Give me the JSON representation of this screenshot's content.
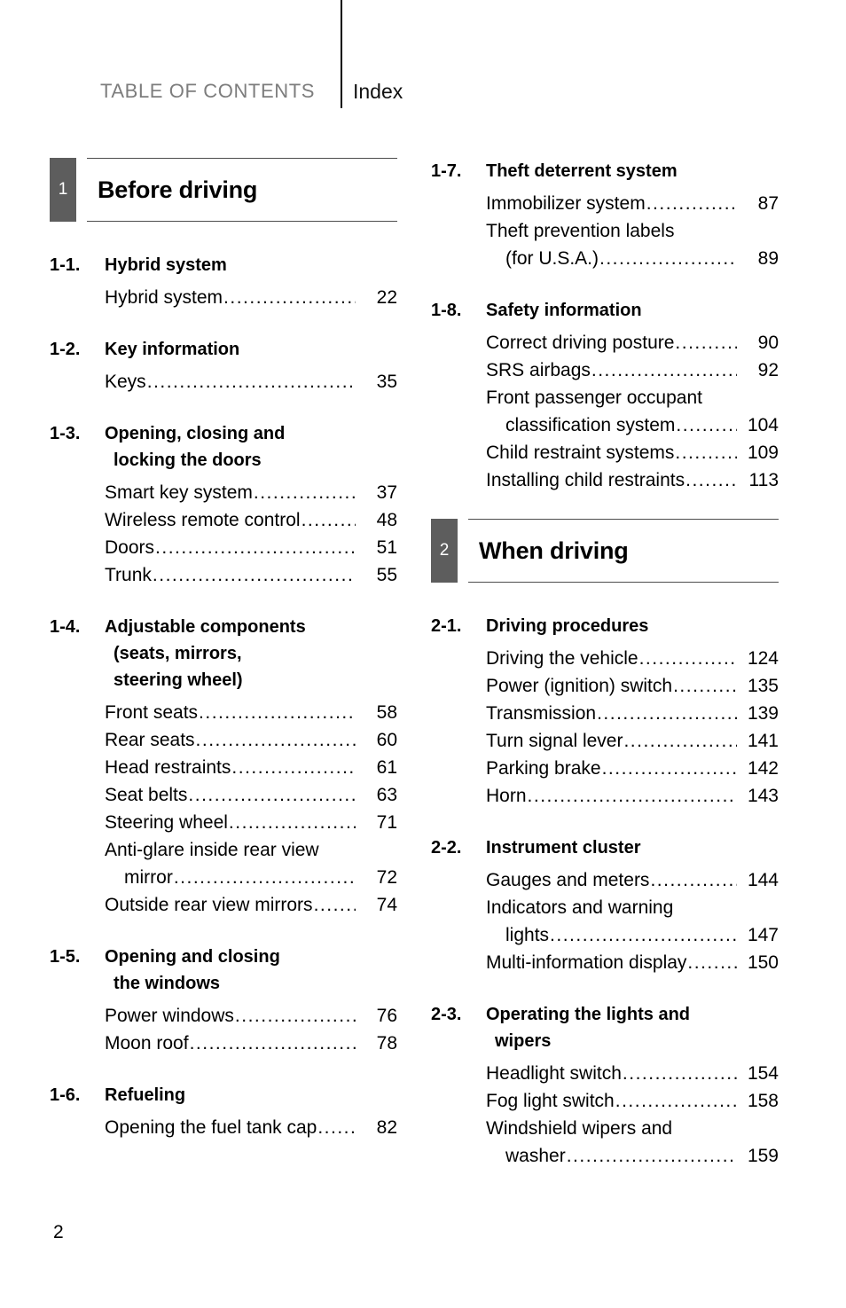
{
  "header": {
    "toc_label": "TABLE OF CONTENTS",
    "index_label": "Index"
  },
  "folio": "2",
  "colors": {
    "chapter_box": "#5d5d5d",
    "header_gray": "#7d7d7d",
    "rule": "#4d4d4d"
  },
  "left_column": {
    "chapter": {
      "number": "1",
      "title": "Before driving"
    },
    "sections": [
      {
        "no": "1-1.",
        "title_lines": [
          "Hybrid system"
        ],
        "entries": [
          {
            "lines": [
              "Hybrid system"
            ],
            "page": "22"
          }
        ]
      },
      {
        "no": "1-2.",
        "title_lines": [
          "Key information"
        ],
        "entries": [
          {
            "lines": [
              "Keys"
            ],
            "page": "35"
          }
        ]
      },
      {
        "no": "1-3.",
        "title_lines": [
          "Opening, closing and",
          "locking the doors"
        ],
        "entries": [
          {
            "lines": [
              "Smart key system"
            ],
            "page": "37"
          },
          {
            "lines": [
              "Wireless remote control"
            ],
            "page": "48"
          },
          {
            "lines": [
              "Doors"
            ],
            "page": "51"
          },
          {
            "lines": [
              "Trunk"
            ],
            "page": "55"
          }
        ]
      },
      {
        "no": "1-4.",
        "title_lines": [
          "Adjustable components",
          "(seats, mirrors,",
          "steering wheel)"
        ],
        "entries": [
          {
            "lines": [
              "Front seats"
            ],
            "page": "58"
          },
          {
            "lines": [
              "Rear seats"
            ],
            "page": "60"
          },
          {
            "lines": [
              "Head restraints"
            ],
            "page": "61"
          },
          {
            "lines": [
              "Seat belts"
            ],
            "page": "63"
          },
          {
            "lines": [
              "Steering wheel"
            ],
            "page": "71"
          },
          {
            "lines": [
              "Anti-glare inside rear view",
              "mirror"
            ],
            "page": "72"
          },
          {
            "lines": [
              "Outside rear view mirrors"
            ],
            "page": "74"
          }
        ]
      },
      {
        "no": "1-5.",
        "title_lines": [
          "Opening and closing",
          "the windows"
        ],
        "entries": [
          {
            "lines": [
              "Power windows"
            ],
            "page": "76"
          },
          {
            "lines": [
              "Moon roof"
            ],
            "page": "78"
          }
        ]
      },
      {
        "no": "1-6.",
        "title_lines": [
          "Refueling"
        ],
        "entries": [
          {
            "lines": [
              "Opening the fuel tank cap"
            ],
            "page": "82"
          }
        ]
      }
    ]
  },
  "right_column": {
    "sections_before_chapter": [
      {
        "no": "1-7.",
        "title_lines": [
          "Theft deterrent system"
        ],
        "entries": [
          {
            "lines": [
              "Immobilizer system"
            ],
            "page": "87"
          },
          {
            "lines": [
              "Theft prevention labels",
              "(for U.S.A.)"
            ],
            "page": "89"
          }
        ]
      },
      {
        "no": "1-8.",
        "title_lines": [
          "Safety information"
        ],
        "entries": [
          {
            "lines": [
              "Correct driving posture"
            ],
            "page": "90"
          },
          {
            "lines": [
              "SRS airbags"
            ],
            "page": "92"
          },
          {
            "lines": [
              "Front passenger occupant",
              "classification system"
            ],
            "page": "104"
          },
          {
            "lines": [
              "Child restraint systems"
            ],
            "page": "109"
          },
          {
            "lines": [
              "Installing child restraints"
            ],
            "page": "113"
          }
        ]
      }
    ],
    "chapter": {
      "number": "2",
      "title": "When driving"
    },
    "sections": [
      {
        "no": "2-1.",
        "title_lines": [
          "Driving procedures"
        ],
        "entries": [
          {
            "lines": [
              "Driving the vehicle"
            ],
            "page": "124"
          },
          {
            "lines": [
              "Power (ignition) switch"
            ],
            "page": "135"
          },
          {
            "lines": [
              "Transmission"
            ],
            "page": "139"
          },
          {
            "lines": [
              "Turn signal lever"
            ],
            "page": "141"
          },
          {
            "lines": [
              "Parking brake"
            ],
            "page": "142"
          },
          {
            "lines": [
              "Horn"
            ],
            "page": "143"
          }
        ]
      },
      {
        "no": "2-2.",
        "title_lines": [
          "Instrument cluster"
        ],
        "entries": [
          {
            "lines": [
              "Gauges and meters"
            ],
            "page": "144"
          },
          {
            "lines": [
              "Indicators and warning",
              "lights"
            ],
            "page": "147"
          },
          {
            "lines": [
              "Multi-information display"
            ],
            "page": "150"
          }
        ]
      },
      {
        "no": "2-3.",
        "title_lines": [
          "Operating the lights and",
          "wipers"
        ],
        "entries": [
          {
            "lines": [
              "Headlight switch"
            ],
            "page": "154"
          },
          {
            "lines": [
              "Fog light switch"
            ],
            "page": "158"
          },
          {
            "lines": [
              "Windshield wipers and",
              "washer"
            ],
            "page": "159"
          }
        ]
      }
    ]
  }
}
